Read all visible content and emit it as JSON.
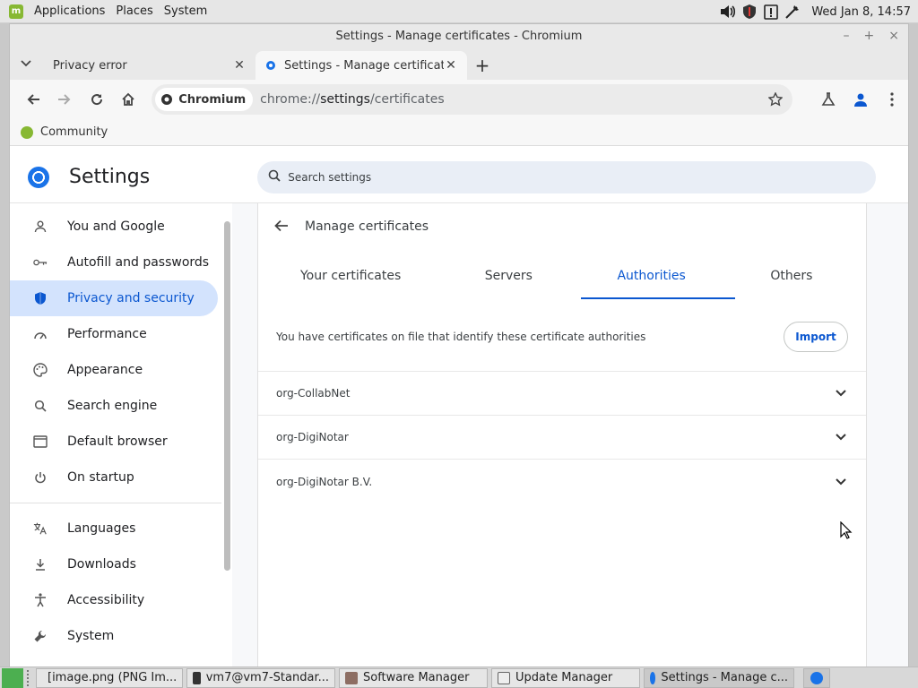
{
  "panel": {
    "menus": [
      "Applications",
      "Places",
      "System"
    ],
    "clock": "Wed Jan  8, 14:57"
  },
  "window": {
    "title": "Settings - Manage certificates - Chromium",
    "tabs": [
      {
        "title": "Privacy error"
      },
      {
        "title": "Settings - Manage certificates"
      }
    ],
    "chip_label": "Chromium",
    "url_scheme": "chrome://",
    "url_host": "settings",
    "url_path": "/certificates",
    "bookmark": "Community"
  },
  "settings": {
    "title": "Settings",
    "search_placeholder": "Search settings",
    "nav": [
      {
        "label": "You and Google",
        "icon": "person-icon"
      },
      {
        "label": "Autofill and passwords",
        "icon": "key-icon"
      },
      {
        "label": "Privacy and security",
        "icon": "shield-icon"
      },
      {
        "label": "Performance",
        "icon": "speedometer-icon"
      },
      {
        "label": "Appearance",
        "icon": "palette-icon"
      },
      {
        "label": "Search engine",
        "icon": "search-icon"
      },
      {
        "label": "Default browser",
        "icon": "browser-icon"
      },
      {
        "label": "On startup",
        "icon": "power-icon"
      },
      {
        "label": "Languages",
        "icon": "translate-icon"
      },
      {
        "label": "Downloads",
        "icon": "download-icon"
      },
      {
        "label": "Accessibility",
        "icon": "accessibility-icon"
      },
      {
        "label": "System",
        "icon": "wrench-icon"
      }
    ],
    "page_title": "Manage certificates",
    "cert_tabs": [
      "Your certificates",
      "Servers",
      "Authorities",
      "Others"
    ],
    "selected_tab": "Authorities",
    "description": "You have certificates on file that identify these certificate authorities",
    "import_label": "Import",
    "authorities": [
      "org-CollabNet",
      "org-DigiNotar",
      "org-DigiNotar B.V."
    ]
  },
  "taskbar": {
    "tasks": [
      "[image.png (PNG Im...",
      "vm7@vm7-Standar...",
      "Software Manager",
      "Update Manager",
      "Settings - Manage c..."
    ]
  },
  "colors": {
    "accent": "#0b57d0",
    "selected_nav_bg": "#d3e3fd",
    "mint_green": "#87b833"
  }
}
